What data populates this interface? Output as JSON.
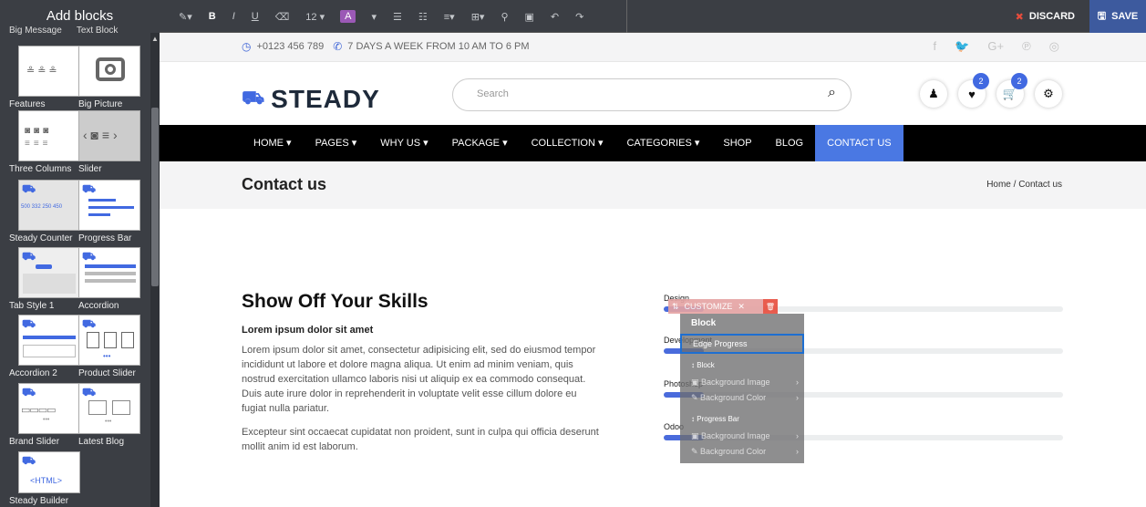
{
  "sidebar": {
    "title": "Add blocks",
    "top_labels": [
      "Big Message",
      "Text Block"
    ],
    "snippets": [
      {
        "label": "Features",
        "icon": "features-icon"
      },
      {
        "label": "Big Picture",
        "icon": "camera-icon"
      },
      {
        "label": "Three Columns",
        "icon": "three-columns-icon"
      },
      {
        "label": "Slider",
        "icon": "slider-icon"
      },
      {
        "label": "Steady Counter",
        "icon": "counter-icon"
      },
      {
        "label": "Progress Bar",
        "icon": "progress-bar-icon"
      },
      {
        "label": "Tab Style 1",
        "icon": "tab-icon"
      },
      {
        "label": "Accordion",
        "icon": "accordion-icon"
      },
      {
        "label": "Accordion 2",
        "icon": "accordion-icon"
      },
      {
        "label": "Product Slider",
        "icon": "product-slider-icon"
      },
      {
        "label": "Brand Slider",
        "icon": "brand-slider-icon"
      },
      {
        "label": "Latest Blog",
        "icon": "blog-icon"
      },
      {
        "label": "Steady Builder",
        "icon": "html-icon"
      }
    ],
    "html_badge": "<HTML>",
    "counter_text": "500 332 250 450"
  },
  "toolbar": {
    "font_size": "12",
    "discard_label": "DISCARD",
    "save_label": "SAVE"
  },
  "site": {
    "phone": "+0123 456 789",
    "hours": "7 DAYS A WEEK FROM 10 AM TO 6 PM",
    "brand": "STEADY",
    "search_placeholder": "Search",
    "wishlist_count": "2",
    "cart_count": "2",
    "nav": [
      "HOME",
      "PAGES",
      "WHY US",
      "PACKAGE",
      "COLLECTION",
      "CATEGORIES",
      "SHOP",
      "BLOG",
      "CONTACT US"
    ],
    "page_title": "Contact us",
    "breadcrumb": "Home  /  Contact us",
    "section_title": "Show Off Your Skills",
    "subtitle": "Lorem ipsum dolor sit amet",
    "paragraph1": "Lorem ipsum dolor sit amet, consectetur adipisicing elit, sed do eiusmod tempor incididunt ut labore et dolore magna aliqua. Ut enim ad minim veniam, quis nostrud exercitation ullamco laboris nisi ut aliquip ex ea commodo consequat. Duis aute irure dolor in reprehenderit in voluptate velit esse cillum dolore eu fugiat nulla pariatur.",
    "paragraph2": "Excepteur sint occaecat cupidatat non proident, sunt in culpa qui officia deserunt mollit anim id est laborum."
  },
  "skills": [
    {
      "label": "Design",
      "fill": 0.1
    },
    {
      "label": "Development",
      "fill": 0.1
    },
    {
      "label": "Photoshop",
      "fill": 0.1
    },
    {
      "label": "Odoo",
      "fill": 0.1
    }
  ],
  "customize": {
    "label": "CUSTOMIZE",
    "block": "Block",
    "highlight": "Edge Progress",
    "items": [
      {
        "label": "Block"
      },
      {
        "label": "Background Image"
      },
      {
        "label": "Background Color"
      },
      {
        "label": "Progress Bar"
      },
      {
        "label": "Background Image"
      },
      {
        "label": "Background Color"
      }
    ]
  },
  "colors": {
    "accent": "#4a78e3",
    "sidebar": "#3b3e44",
    "save": "#3d5a9e",
    "discard": "#e74c3c"
  }
}
